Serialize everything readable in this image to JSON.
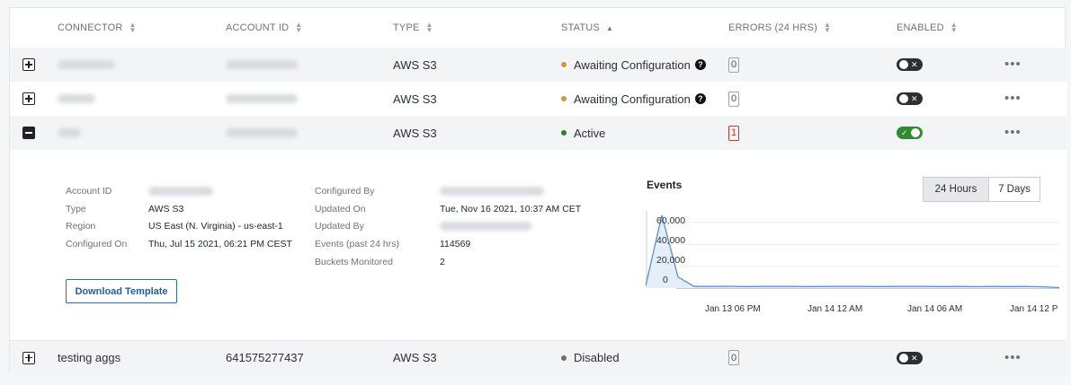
{
  "table": {
    "headers": {
      "connector": "CONNECTOR",
      "account_id": "ACCOUNT ID",
      "type": "TYPE",
      "status": "STATUS",
      "errors": "ERRORS (24 HRS)",
      "enabled": "ENABLED"
    },
    "rows": [
      {
        "type": "AWS S3",
        "status": "Awaiting Configuration",
        "status_color": "#d4953a",
        "errors": "0",
        "enabled": false
      },
      {
        "type": "AWS S3",
        "status": "Awaiting Configuration",
        "status_color": "#d4953a",
        "errors": "0",
        "enabled": false
      },
      {
        "type": "AWS S3",
        "status": "Active",
        "status_color": "#2e7d32",
        "errors": "1",
        "enabled": true
      },
      {
        "connector": "testing aggs",
        "account_id": "641575277437",
        "type": "AWS S3",
        "status": "Disabled",
        "status_color": "#6b6f75",
        "errors": "0",
        "enabled": false
      }
    ]
  },
  "detail": {
    "left": {
      "account_id_label": "Account ID",
      "type_label": "Type",
      "type_value": "AWS S3",
      "region_label": "Region",
      "region_value": "US East (N. Virginia) - us-east-1",
      "configured_on_label": "Configured On",
      "configured_on_value": "Thu, Jul 15 2021, 06:21 PM CEST"
    },
    "right": {
      "configured_by_label": "Configured By",
      "updated_on_label": "Updated On",
      "updated_on_value": "Tue, Nov 16 2021, 10:37 AM CET",
      "updated_by_label": "Updated By",
      "events_label": "Events (past 24 hrs)",
      "events_value": "114569",
      "buckets_label": "Buckets Monitored",
      "buckets_value": "2"
    },
    "download_label": "Download Template"
  },
  "events": {
    "title": "Events",
    "range_options": [
      "24 Hours",
      "7 Days"
    ],
    "selected_range": "24 Hours"
  },
  "chart_data": {
    "type": "area",
    "y_ticks": [
      "0",
      "20,000",
      "40,000",
      "60,000"
    ],
    "x_ticks": [
      "Jan 13 06 PM",
      "Jan 14 12 AM",
      "Jan 14 06 AM",
      "Jan 14 12 P"
    ],
    "ylim": [
      0,
      70000
    ],
    "series": [
      {
        "values": [
          2000,
          66000,
          10000,
          1500,
          1500,
          1600,
          1400,
          1500,
          1500,
          1500,
          1400,
          1500,
          1500,
          1500,
          1400,
          1500,
          1500,
          1500,
          1400,
          1500,
          1300,
          1500,
          1400,
          1500,
          1200,
          400
        ]
      }
    ],
    "colors": {
      "line": "#5b8fd0",
      "fill": "#e4eef9"
    }
  }
}
